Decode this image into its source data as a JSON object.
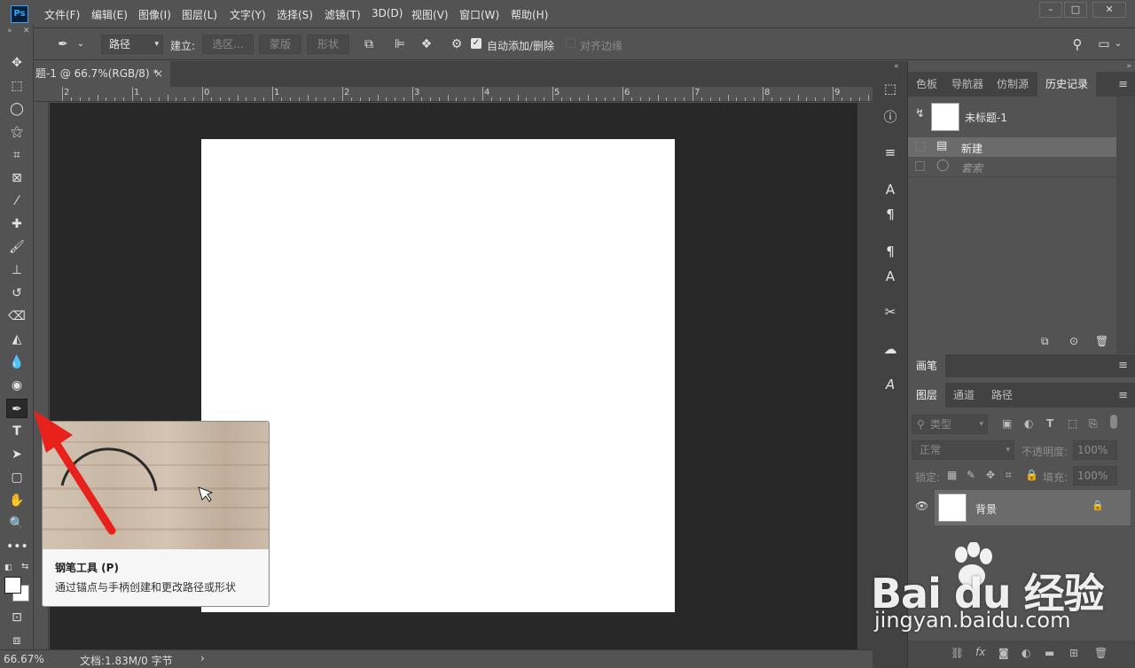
{
  "app": {
    "logo_text": "Ps"
  },
  "menu": [
    "文件(F)",
    "编辑(E)",
    "图像(I)",
    "图层(L)",
    "文字(Y)",
    "选择(S)",
    "滤镜(T)",
    "3D(D)",
    "视图(V)",
    "窗口(W)",
    "帮助(H)"
  ],
  "window_controls": {
    "minimize": "–",
    "restore": "□",
    "close": "✕"
  },
  "options": {
    "mode_value": "路径",
    "build_label": "建立:",
    "selection_btn": "选区...",
    "mask_btn": "蒙版",
    "shape_btn": "形状",
    "auto_add_delete": "自动添加/删除",
    "align_edges": "对齐边缘"
  },
  "document": {
    "tab_title": "题-1 @ 66.7%(RGB/8) *",
    "close_glyph": "×"
  },
  "ruler": {
    "h_labels": [
      "2",
      "1",
      "0",
      "1",
      "2",
      "3",
      "4",
      "5",
      "6",
      "7",
      "8",
      "9"
    ]
  },
  "tooltip": {
    "title": "钢笔工具 (P)",
    "description": "通过锚点与手柄创建和更改路径或形状"
  },
  "status": {
    "zoom": "66.67%",
    "doc_info": "文档:1.83M/0 字节",
    "arrow": "›"
  },
  "panels": {
    "top_tabs": [
      "色板",
      "导航器",
      "仿制源",
      "历史记录"
    ],
    "history": {
      "snapshot_name": "未标题-1",
      "items": [
        "新建",
        "套索"
      ]
    },
    "brush_tab": "画笔",
    "layer_tabs": [
      "图层",
      "通道",
      "路径"
    ],
    "layers": {
      "filter_kind": "类型",
      "blend_mode": "正常",
      "opacity_label": "不透明度:",
      "opacity_value": "100%",
      "lock_label": "锁定:",
      "fill_label": "填充:",
      "fill_value": "100%",
      "layer_name": "背景"
    }
  },
  "watermark": {
    "brand": "Bai du 经验",
    "url": "jingyan.baidu.com"
  },
  "colors": {
    "ui_bg": "#535353",
    "canvas_bg": "#282828",
    "panel_dark": "#424242",
    "arrow_red": "#e8211d"
  }
}
